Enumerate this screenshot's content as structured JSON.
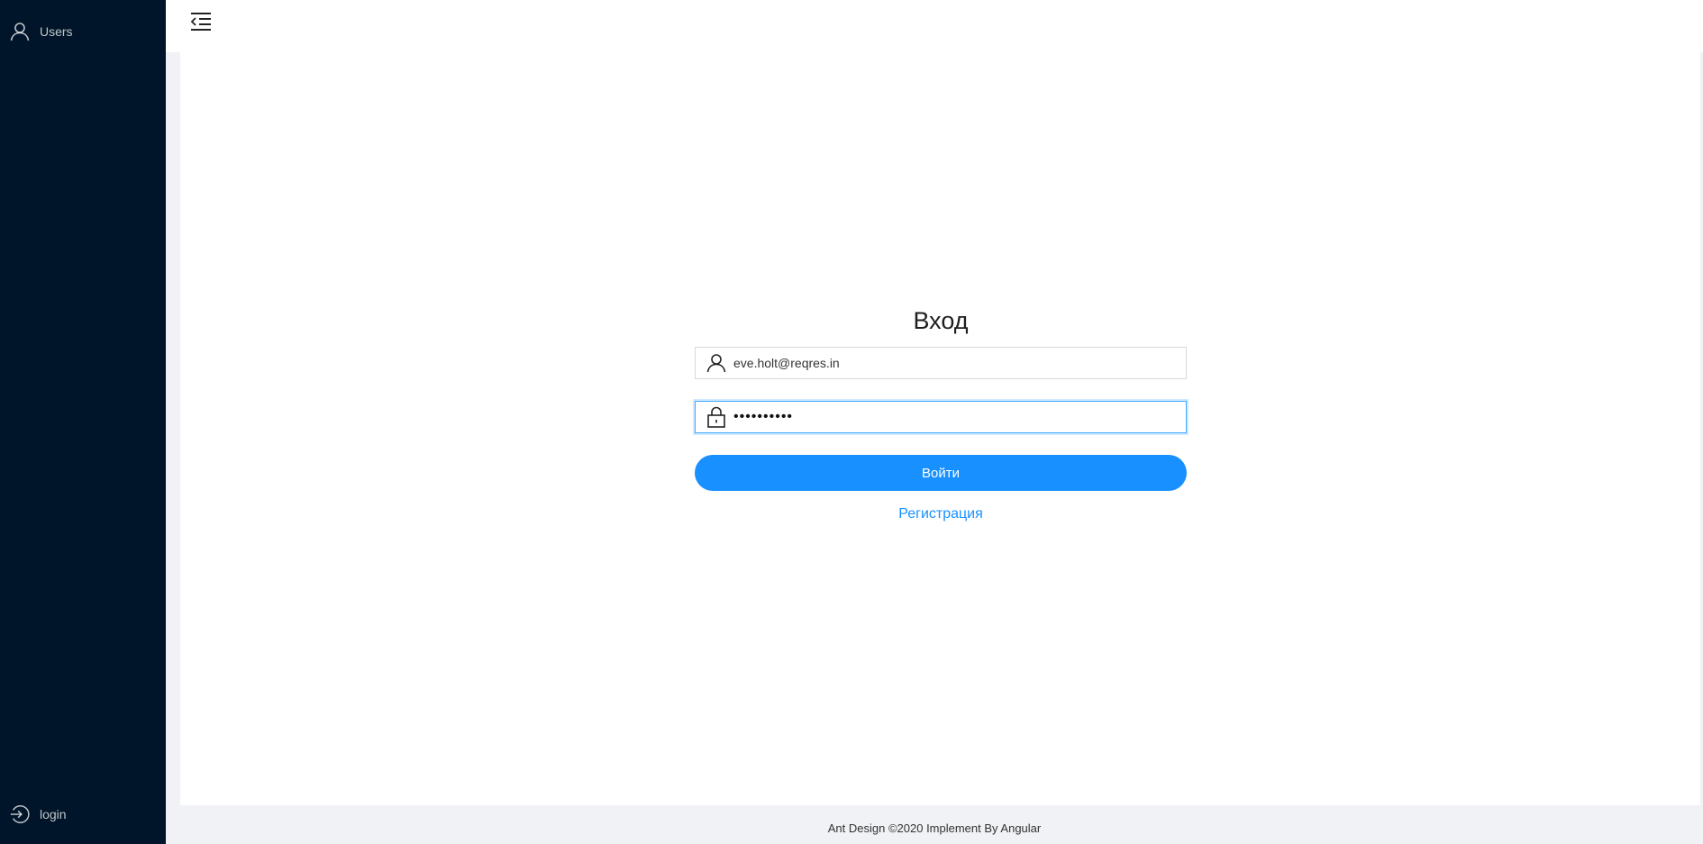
{
  "sidebar": {
    "items": [
      {
        "label": "Users",
        "icon": "user-icon"
      },
      {
        "label": "login",
        "icon": "login-icon"
      }
    ]
  },
  "header": {
    "toggle_icon": "menu-fold-icon"
  },
  "login_form": {
    "title": "Вход",
    "email_value": "eve.holt@reqres.in",
    "password_value": "cityslicka",
    "submit_label": "Войти",
    "register_label": "Регистрация"
  },
  "footer": {
    "text": "Ant Design ©2020 Implement By Angular"
  },
  "colors": {
    "sider_bg": "#001529",
    "primary": "#1890ff",
    "page_bg": "#f0f2f5"
  }
}
